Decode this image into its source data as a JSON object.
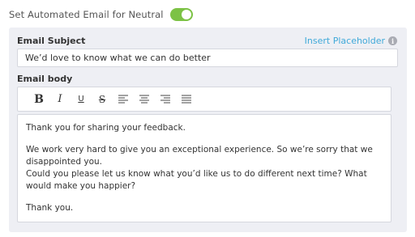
{
  "automated_email": {
    "label": "Set Automated Email for Neutral",
    "enabled": true,
    "toggle_color": "#7cc245"
  },
  "subject": {
    "label": "Email Subject",
    "insert_placeholder": "Insert Placeholder",
    "info_icon": "info-icon",
    "value": "We’d love to know what we can do better"
  },
  "body": {
    "label": "Email body",
    "toolbar": [
      {
        "name": "bold",
        "glyph": "B"
      },
      {
        "name": "italic",
        "glyph": "I"
      },
      {
        "name": "underline",
        "glyph": "U"
      },
      {
        "name": "strikethrough",
        "glyph": "S"
      },
      {
        "name": "align-left",
        "glyph": ""
      },
      {
        "name": "align-center",
        "glyph": ""
      },
      {
        "name": "align-right",
        "glyph": ""
      },
      {
        "name": "justify",
        "glyph": ""
      }
    ],
    "paragraphs": {
      "p1": "Thank you for sharing your feedback.",
      "p2": "We work very hard to give you an exceptional experience. So we’re sorry that we disappointed you.",
      "p3": "Could you please let us know what you’d like us to do different next time? What would make you happier?",
      "p4": "Thank you."
    }
  },
  "colors": {
    "link": "#3fa9d9",
    "panel_bg": "#eeeff4"
  }
}
